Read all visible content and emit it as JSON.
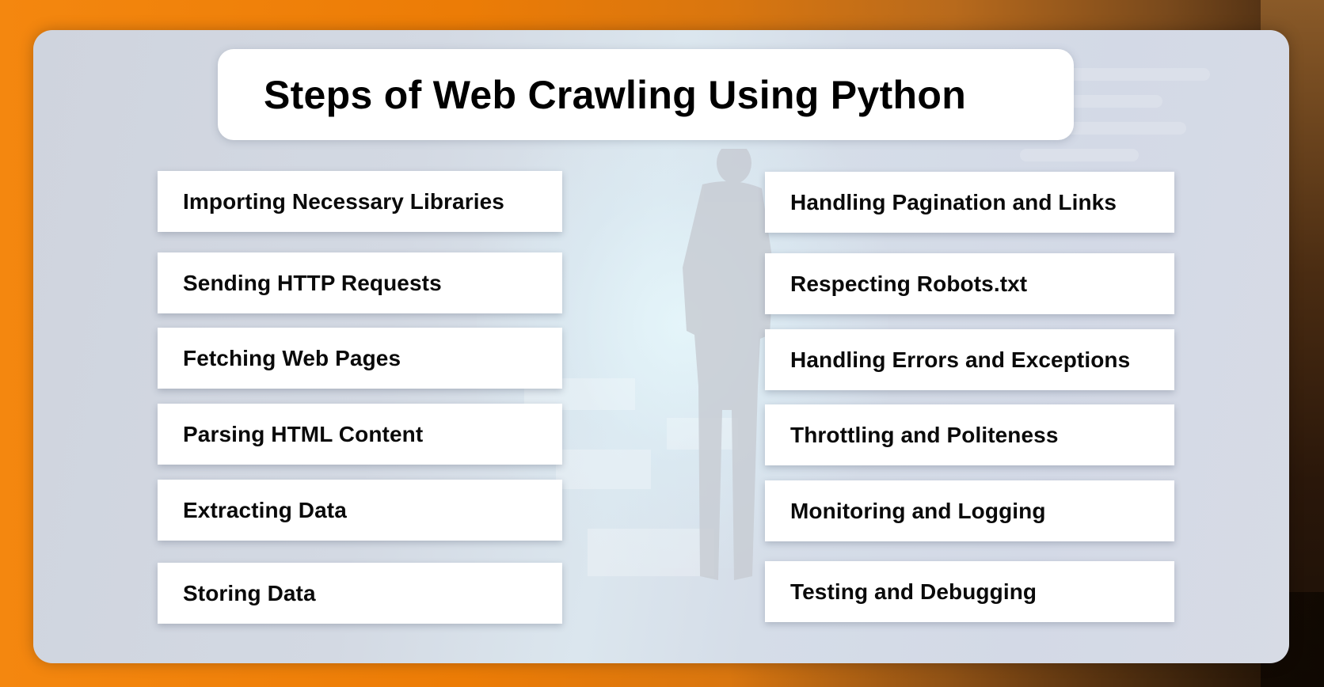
{
  "title": "Steps of Web Crawling Using Python",
  "colors": {
    "frame_orange": "#ec7c06",
    "frame_brown": "#3e2510",
    "panel": "#d3d9e3",
    "card": "#ffffff",
    "text": "#000000"
  },
  "left_steps": [
    {
      "label": "Importing Necessary Libraries"
    },
    {
      "label": "Sending HTTP Requests"
    },
    {
      "label": "Fetching Web Pages"
    },
    {
      "label": "Parsing HTML Content"
    },
    {
      "label": "Extracting Data"
    },
    {
      "label": "Storing Data"
    }
  ],
  "right_steps": [
    {
      "label": "Handling Pagination and Links"
    },
    {
      "label": "Respecting Robots.txt"
    },
    {
      "label": "Handling Errors and Exceptions"
    },
    {
      "label": "Throttling and Politeness"
    },
    {
      "label": "Monitoring and Logging"
    },
    {
      "label": "Testing and Debugging"
    }
  ],
  "background": {
    "image": "person-silhouette-digital-corridor"
  }
}
